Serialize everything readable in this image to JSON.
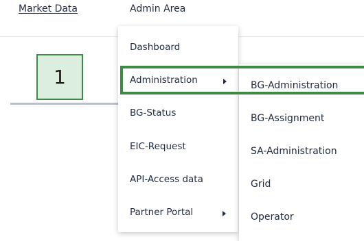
{
  "nav": {
    "market_data": "Market Data",
    "admin_area": "Admin Area"
  },
  "step_badge": "1",
  "admin_menu": {
    "items": [
      {
        "label": "Dashboard",
        "has_submenu": false
      },
      {
        "label": "Administration",
        "has_submenu": true
      },
      {
        "label": "BG-Status",
        "has_submenu": false
      },
      {
        "label": "EIC-Request",
        "has_submenu": false
      },
      {
        "label": "API-Access data",
        "has_submenu": false
      },
      {
        "label": "Partner Portal",
        "has_submenu": true
      }
    ]
  },
  "administration_submenu": {
    "items": [
      {
        "label": "BG-Administration"
      },
      {
        "label": "BG-Assignment"
      },
      {
        "label": "SA-Administration"
      },
      {
        "label": "Grid"
      },
      {
        "label": "Operator"
      }
    ]
  },
  "colors": {
    "highlight": "#3c8a44",
    "badge_bg": "#dceedd",
    "text": "#1f2a44"
  }
}
